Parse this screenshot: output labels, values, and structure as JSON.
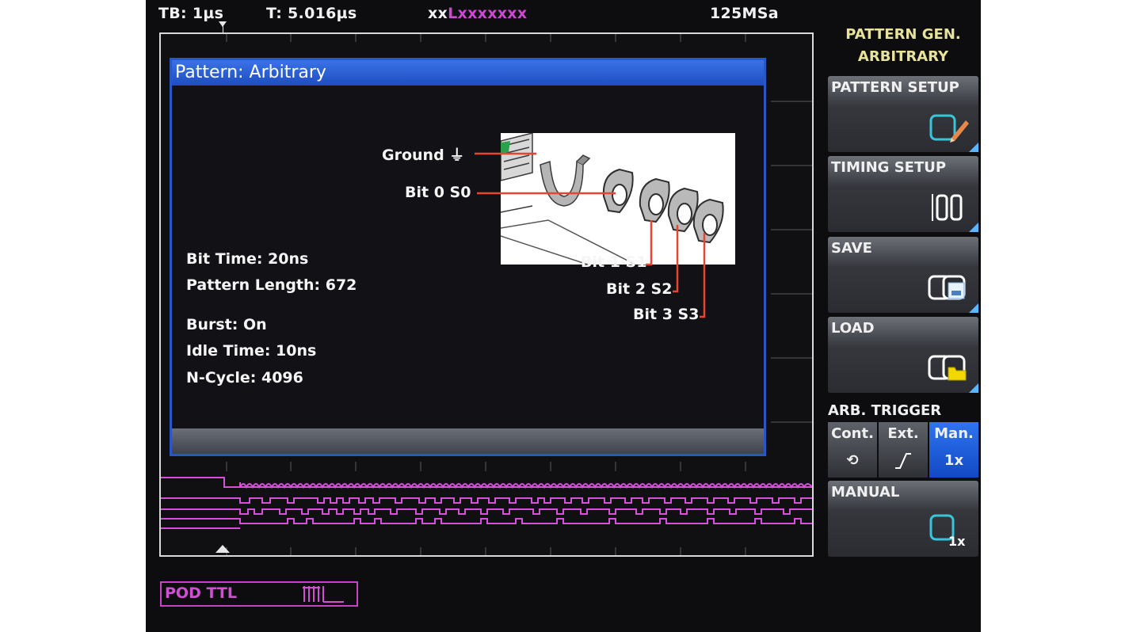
{
  "status_bar": {
    "timebase": "TB: 1µs",
    "trigger_time": "T: 5.016µs",
    "trigger_pattern_prefix": "xx",
    "trigger_pattern": "Lxxxxxxx",
    "sample_rate": "125MSa"
  },
  "dialog": {
    "title": "Pattern: Arbitrary",
    "bit_time": "Bit Time: 20ns",
    "pattern_length": "Pattern Length: 672",
    "burst": "Burst: On",
    "idle_time": "Idle Time: 10ns",
    "n_cycle": "N-Cycle: 4096",
    "pins": {
      "ground": "Ground",
      "bit0": "Bit 0 S0",
      "bit1": "Bit 1 S1",
      "bit2": "Bit 2 S2",
      "bit3": "Bit 3 S3"
    }
  },
  "menu": {
    "title_line1": "PATTERN GEN.",
    "title_line2": "ARBITRARY",
    "softkeys": {
      "pattern_setup": "PATTERN SETUP",
      "timing_setup": "TIMING SETUP",
      "save": "SAVE",
      "load": "LOAD",
      "manual": "MANUAL"
    },
    "arb_trigger": {
      "label": "ARB. TRIGGER",
      "options": [
        "Cont.",
        "Ext.",
        "Man."
      ],
      "man_icon": "1x",
      "selected": "Man."
    }
  },
  "pod": {
    "label": "POD TTL"
  },
  "colors": {
    "digital_trace": "#d84fdc",
    "dialog_title": "#2a5fd9",
    "menu_title": "#e8e39a",
    "wire": "#e8442e",
    "active_option": "#1f5fe0"
  },
  "icons": {
    "pattern_setup": "edit-pattern-icon",
    "timing_setup": "timing-icon",
    "save": "save-icon",
    "load": "load-icon",
    "manual": "manual-trigger-icon",
    "cont": "continuous-loop-icon",
    "ext": "rising-edge-icon",
    "ground": "ground-icon"
  }
}
